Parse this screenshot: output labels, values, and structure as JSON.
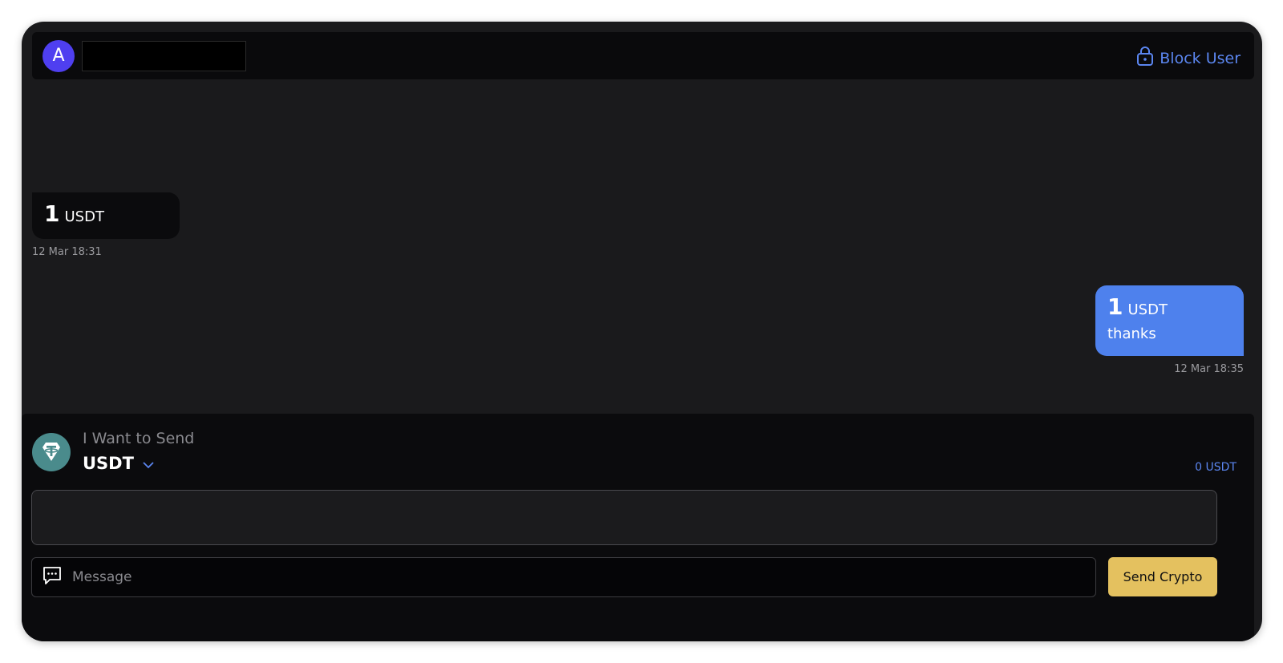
{
  "header": {
    "avatar_letter": "A",
    "block_user_label": "Block User"
  },
  "messages": [
    {
      "direction": "incoming",
      "amount": "1",
      "currency": "USDT",
      "text": "",
      "time": "12 Mar 18:31"
    },
    {
      "direction": "outgoing",
      "amount": "1",
      "currency": "USDT",
      "text": "thanks",
      "time": "12 Mar 18:35"
    }
  ],
  "composer": {
    "want_label": "I Want to Send",
    "currency": "USDT",
    "balance": "0 USDT",
    "amount_value": "",
    "message_placeholder": "Message",
    "send_button_label": "Send Crypto"
  },
  "colors": {
    "accent": "#5b86f0",
    "outgoing_bubble": "#4e81ed",
    "send_button": "#e4c15f",
    "avatar": "#4f3ff0",
    "coin": "#4a8b8c"
  }
}
